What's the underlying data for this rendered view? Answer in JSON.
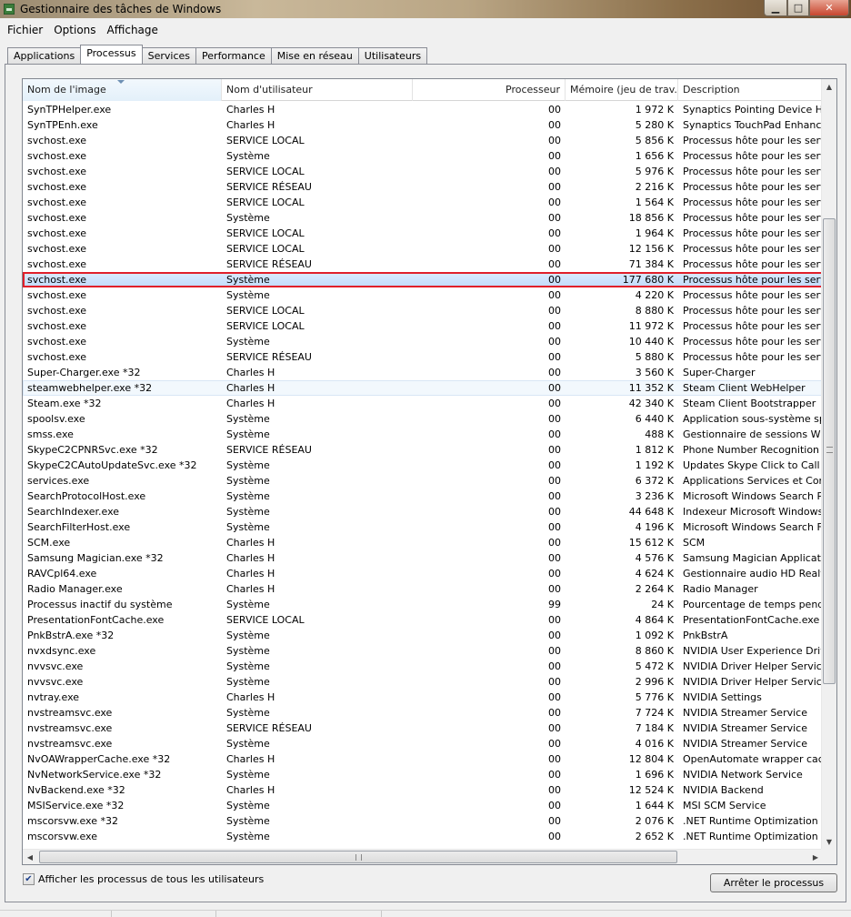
{
  "window": {
    "title": "Gestionnaire des tâches de Windows"
  },
  "menu": [
    "Fichier",
    "Options",
    "Affichage"
  ],
  "tabs": [
    "Applications",
    "Processus",
    "Services",
    "Performance",
    "Mise en réseau",
    "Utilisateurs"
  ],
  "columns": [
    "Nom de l'image",
    "Nom d'utilisateur",
    "Processeur",
    "Mémoire (jeu de trav...",
    "Description"
  ],
  "rows": [
    [
      "SynTPHelper.exe",
      "Charles H",
      "00",
      "1 972 K",
      "Synaptics Pointing Device Helper"
    ],
    [
      "SynTPEnh.exe",
      "Charles H",
      "00",
      "5 280 K",
      "Synaptics TouchPad Enhancements"
    ],
    [
      "svchost.exe",
      "SERVICE LOCAL",
      "00",
      "5 856 K",
      "Processus hôte pour les services"
    ],
    [
      "svchost.exe",
      "Système",
      "00",
      "1 656 K",
      "Processus hôte pour les services"
    ],
    [
      "svchost.exe",
      "SERVICE LOCAL",
      "00",
      "5 976 K",
      "Processus hôte pour les services"
    ],
    [
      "svchost.exe",
      "SERVICE RÉSEAU",
      "00",
      "2 216 K",
      "Processus hôte pour les services"
    ],
    [
      "svchost.exe",
      "SERVICE LOCAL",
      "00",
      "1 564 K",
      "Processus hôte pour les services"
    ],
    [
      "svchost.exe",
      "Système",
      "00",
      "18 856 K",
      "Processus hôte pour les services"
    ],
    [
      "svchost.exe",
      "SERVICE LOCAL",
      "00",
      "1 964 K",
      "Processus hôte pour les services"
    ],
    [
      "svchost.exe",
      "SERVICE LOCAL",
      "00",
      "12 156 K",
      "Processus hôte pour les services"
    ],
    [
      "svchost.exe",
      "SERVICE RÉSEAU",
      "00",
      "71 384 K",
      "Processus hôte pour les services"
    ],
    [
      "svchost.exe",
      "Système",
      "00",
      "177 680 K",
      "Processus hôte pour les services"
    ],
    [
      "svchost.exe",
      "Système",
      "00",
      "4 220 K",
      "Processus hôte pour les services"
    ],
    [
      "svchost.exe",
      "SERVICE LOCAL",
      "00",
      "8 880 K",
      "Processus hôte pour les services"
    ],
    [
      "svchost.exe",
      "SERVICE LOCAL",
      "00",
      "11 972 K",
      "Processus hôte pour les services"
    ],
    [
      "svchost.exe",
      "Système",
      "00",
      "10 440 K",
      "Processus hôte pour les services"
    ],
    [
      "svchost.exe",
      "SERVICE RÉSEAU",
      "00",
      "5 880 K",
      "Processus hôte pour les services"
    ],
    [
      "Super-Charger.exe *32",
      "Charles H",
      "00",
      "3 560 K",
      "Super-Charger"
    ],
    [
      "steamwebhelper.exe *32",
      "Charles H",
      "00",
      "11 352 K",
      "Steam Client WebHelper"
    ],
    [
      "Steam.exe *32",
      "Charles H",
      "00",
      "42 340 K",
      "Steam Client Bootstrapper"
    ],
    [
      "spoolsv.exe",
      "Système",
      "00",
      "6 440 K",
      "Application sous-système spouleur"
    ],
    [
      "smss.exe",
      "Système",
      "00",
      "488 K",
      "Gestionnaire de sessions Windows"
    ],
    [
      "SkypeC2CPNRSvc.exe *32",
      "SERVICE RÉSEAU",
      "00",
      "1 812 K",
      "Phone Number Recognition (PNR)"
    ],
    [
      "SkypeC2CAutoUpdateSvc.exe *32",
      "Système",
      "00",
      "1 192 K",
      "Updates Skype Click to Call"
    ],
    [
      "services.exe",
      "Système",
      "00",
      "6 372 K",
      "Applications Services et Contrôleur"
    ],
    [
      "SearchProtocolHost.exe",
      "Système",
      "00",
      "3 236 K",
      "Microsoft Windows Search Protocol"
    ],
    [
      "SearchIndexer.exe",
      "Système",
      "00",
      "44 648 K",
      "Indexeur Microsoft Windows Search"
    ],
    [
      "SearchFilterHost.exe",
      "Système",
      "00",
      "4 196 K",
      "Microsoft Windows Search Filter"
    ],
    [
      "SCM.exe",
      "Charles H",
      "00",
      "15 612 K",
      "SCM"
    ],
    [
      "Samsung Magician.exe *32",
      "Charles H",
      "00",
      "4 576 K",
      "Samsung Magician Application"
    ],
    [
      "RAVCpl64.exe",
      "Charles H",
      "00",
      "4 624 K",
      "Gestionnaire audio HD Realtek"
    ],
    [
      "Radio Manager.exe",
      "Charles H",
      "00",
      "2 264 K",
      "Radio Manager"
    ],
    [
      "Processus inactif du système",
      "Système",
      "99",
      "24 K",
      "Pourcentage de temps pendant"
    ],
    [
      "PresentationFontCache.exe",
      "SERVICE LOCAL",
      "00",
      "4 864 K",
      "PresentationFontCache.exe"
    ],
    [
      "PnkBstrA.exe *32",
      "Système",
      "00",
      "1 092 K",
      "PnkBstrA"
    ],
    [
      "nvxdsync.exe",
      "Système",
      "00",
      "8 860 K",
      "NVIDIA User Experience Driver"
    ],
    [
      "nvvsvc.exe",
      "Système",
      "00",
      "5 472 K",
      "NVIDIA Driver Helper Service, V"
    ],
    [
      "nvvsvc.exe",
      "Système",
      "00",
      "2 996 K",
      "NVIDIA Driver Helper Service, V"
    ],
    [
      "nvtray.exe",
      "Charles H",
      "00",
      "5 776 K",
      "NVIDIA Settings"
    ],
    [
      "nvstreamsvc.exe",
      "Système",
      "00",
      "7 724 K",
      "NVIDIA Streamer Service"
    ],
    [
      "nvstreamsvc.exe",
      "SERVICE RÉSEAU",
      "00",
      "7 184 K",
      "NVIDIA Streamer Service"
    ],
    [
      "nvstreamsvc.exe",
      "Système",
      "00",
      "4 016 K",
      "NVIDIA Streamer Service"
    ],
    [
      "NvOAWrapperCache.exe *32",
      "Charles H",
      "00",
      "12 804 K",
      "OpenAutomate wrapper cache"
    ],
    [
      "NvNetworkService.exe *32",
      "Système",
      "00",
      "1 696 K",
      "NVIDIA Network Service"
    ],
    [
      "NvBackend.exe *32",
      "Charles H",
      "00",
      "12 524 K",
      "NVIDIA Backend"
    ],
    [
      "MSIService.exe *32",
      "Système",
      "00",
      "1 644 K",
      "MSI SCM Service"
    ],
    [
      "mscorsvw.exe *32",
      "Système",
      "00",
      "2 076 K",
      ".NET Runtime Optimization Service"
    ],
    [
      "mscorsvw.exe",
      "Système",
      "00",
      "2 652 K",
      ".NET Runtime Optimization Service"
    ]
  ],
  "selected_row_index": 11,
  "hover_row_index": 18,
  "checkbox": {
    "label": "Afficher les processus de tous les utilisateurs",
    "checked": true
  },
  "end_process_button": "Arrêter le processus",
  "colors": {
    "highlight_border": "#e0202a",
    "selection": "#c1dbfc"
  }
}
